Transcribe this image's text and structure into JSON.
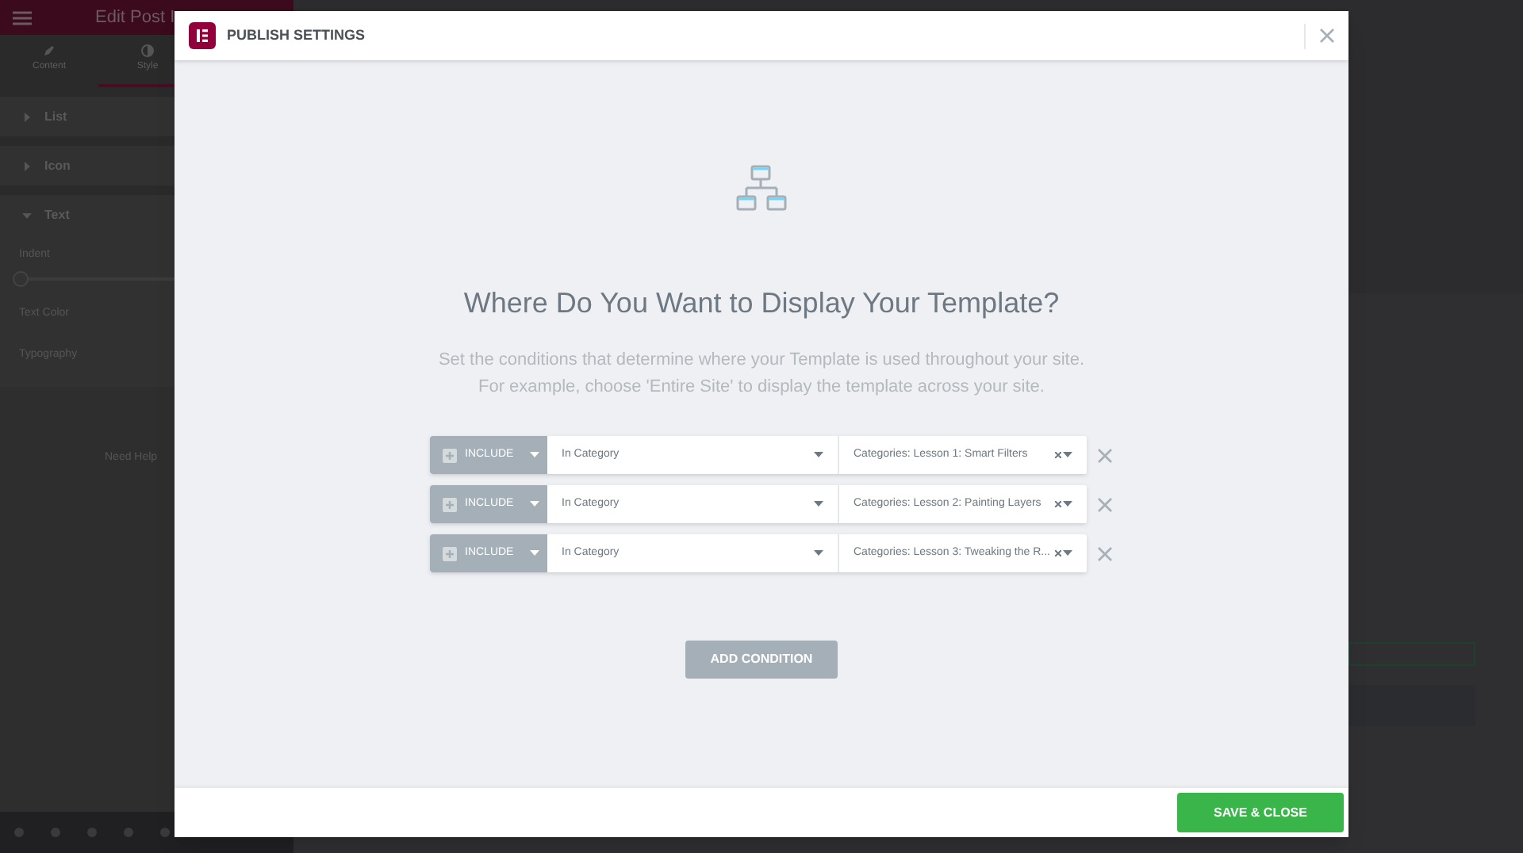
{
  "editor_panel": {
    "title": "Edit Post I",
    "tabs": [
      {
        "label": "Content",
        "selected": false
      },
      {
        "label": "Style",
        "selected": true
      }
    ],
    "sections": [
      {
        "label": "List",
        "expanded": false
      },
      {
        "label": "Icon",
        "expanded": false
      },
      {
        "label": "Text",
        "expanded": true
      }
    ],
    "controls": [
      {
        "kind": "slider",
        "label": "Indent",
        "level": 0
      },
      {
        "kind": "plain",
        "label": "Text Color"
      },
      {
        "kind": "plain",
        "label": "Typography"
      }
    ],
    "help": "Need Help"
  },
  "modal": {
    "title": "PUBLISH SETTINGS",
    "heading": "Where Do You Want to Display Your Template?",
    "description": "Set the conditions that determine where your Template is used throughout your site. For example, choose 'Entire Site' to display the template across your site.",
    "conditions": [
      {
        "type": "INCLUDE",
        "rule": "In Category",
        "value": "Categories: Lesson 1: Smart Filters"
      },
      {
        "type": "INCLUDE",
        "rule": "In Category",
        "value": "Categories: Lesson 2: Painting Layers"
      },
      {
        "type": "INCLUDE",
        "rule": "In Category",
        "value": "Categories: Lesson 3: Tweaking the R..."
      }
    ],
    "add_button": "ADD CONDITION",
    "save_button": "SAVE & CLOSE"
  }
}
